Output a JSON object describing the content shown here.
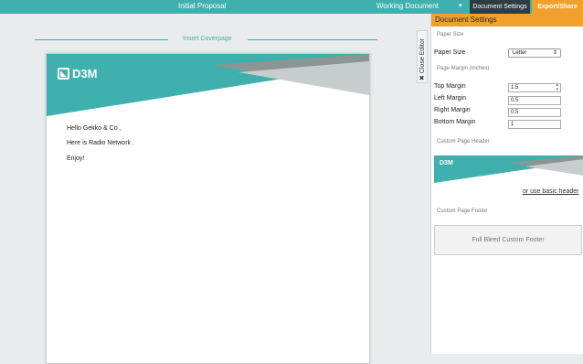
{
  "topbar": {
    "title": "Initial Proposal",
    "doc_select": "Working Document",
    "settings_label": "Document Settings",
    "export_label": "Export/Share",
    "colors": {
      "teal": "#3fb0ad",
      "dark": "#2d3d44",
      "orange": "#f0a02b"
    }
  },
  "editor": {
    "insert_coverpage": "Insert Coverpage",
    "close_editor": "Close Editor",
    "page": {
      "logo": "D3M",
      "lines": [
        "Hello Gekko & Co ,",
        "Here is Radio Network .",
        "Enjoy!"
      ]
    }
  },
  "panel": {
    "title": "Document Settings",
    "paper_size_section": "Paper Size",
    "paper_size_label": "Paper Size",
    "paper_size_value": "Letter",
    "margin_section": "Page Margin (Inches)",
    "margins": [
      {
        "label": "Top Margin",
        "value": "1.5"
      },
      {
        "label": "Left Margin",
        "value": "0.5"
      },
      {
        "label": "Right Margin",
        "value": "0.5"
      },
      {
        "label": "Bottom Margin",
        "value": "1"
      }
    ],
    "header_section": "Custom Page Header",
    "header_logo": "D3M",
    "basic_header_link": "or use basic header",
    "footer_section": "Custom Page Footer",
    "footer_button": "Full Bleed Custom Footer"
  }
}
